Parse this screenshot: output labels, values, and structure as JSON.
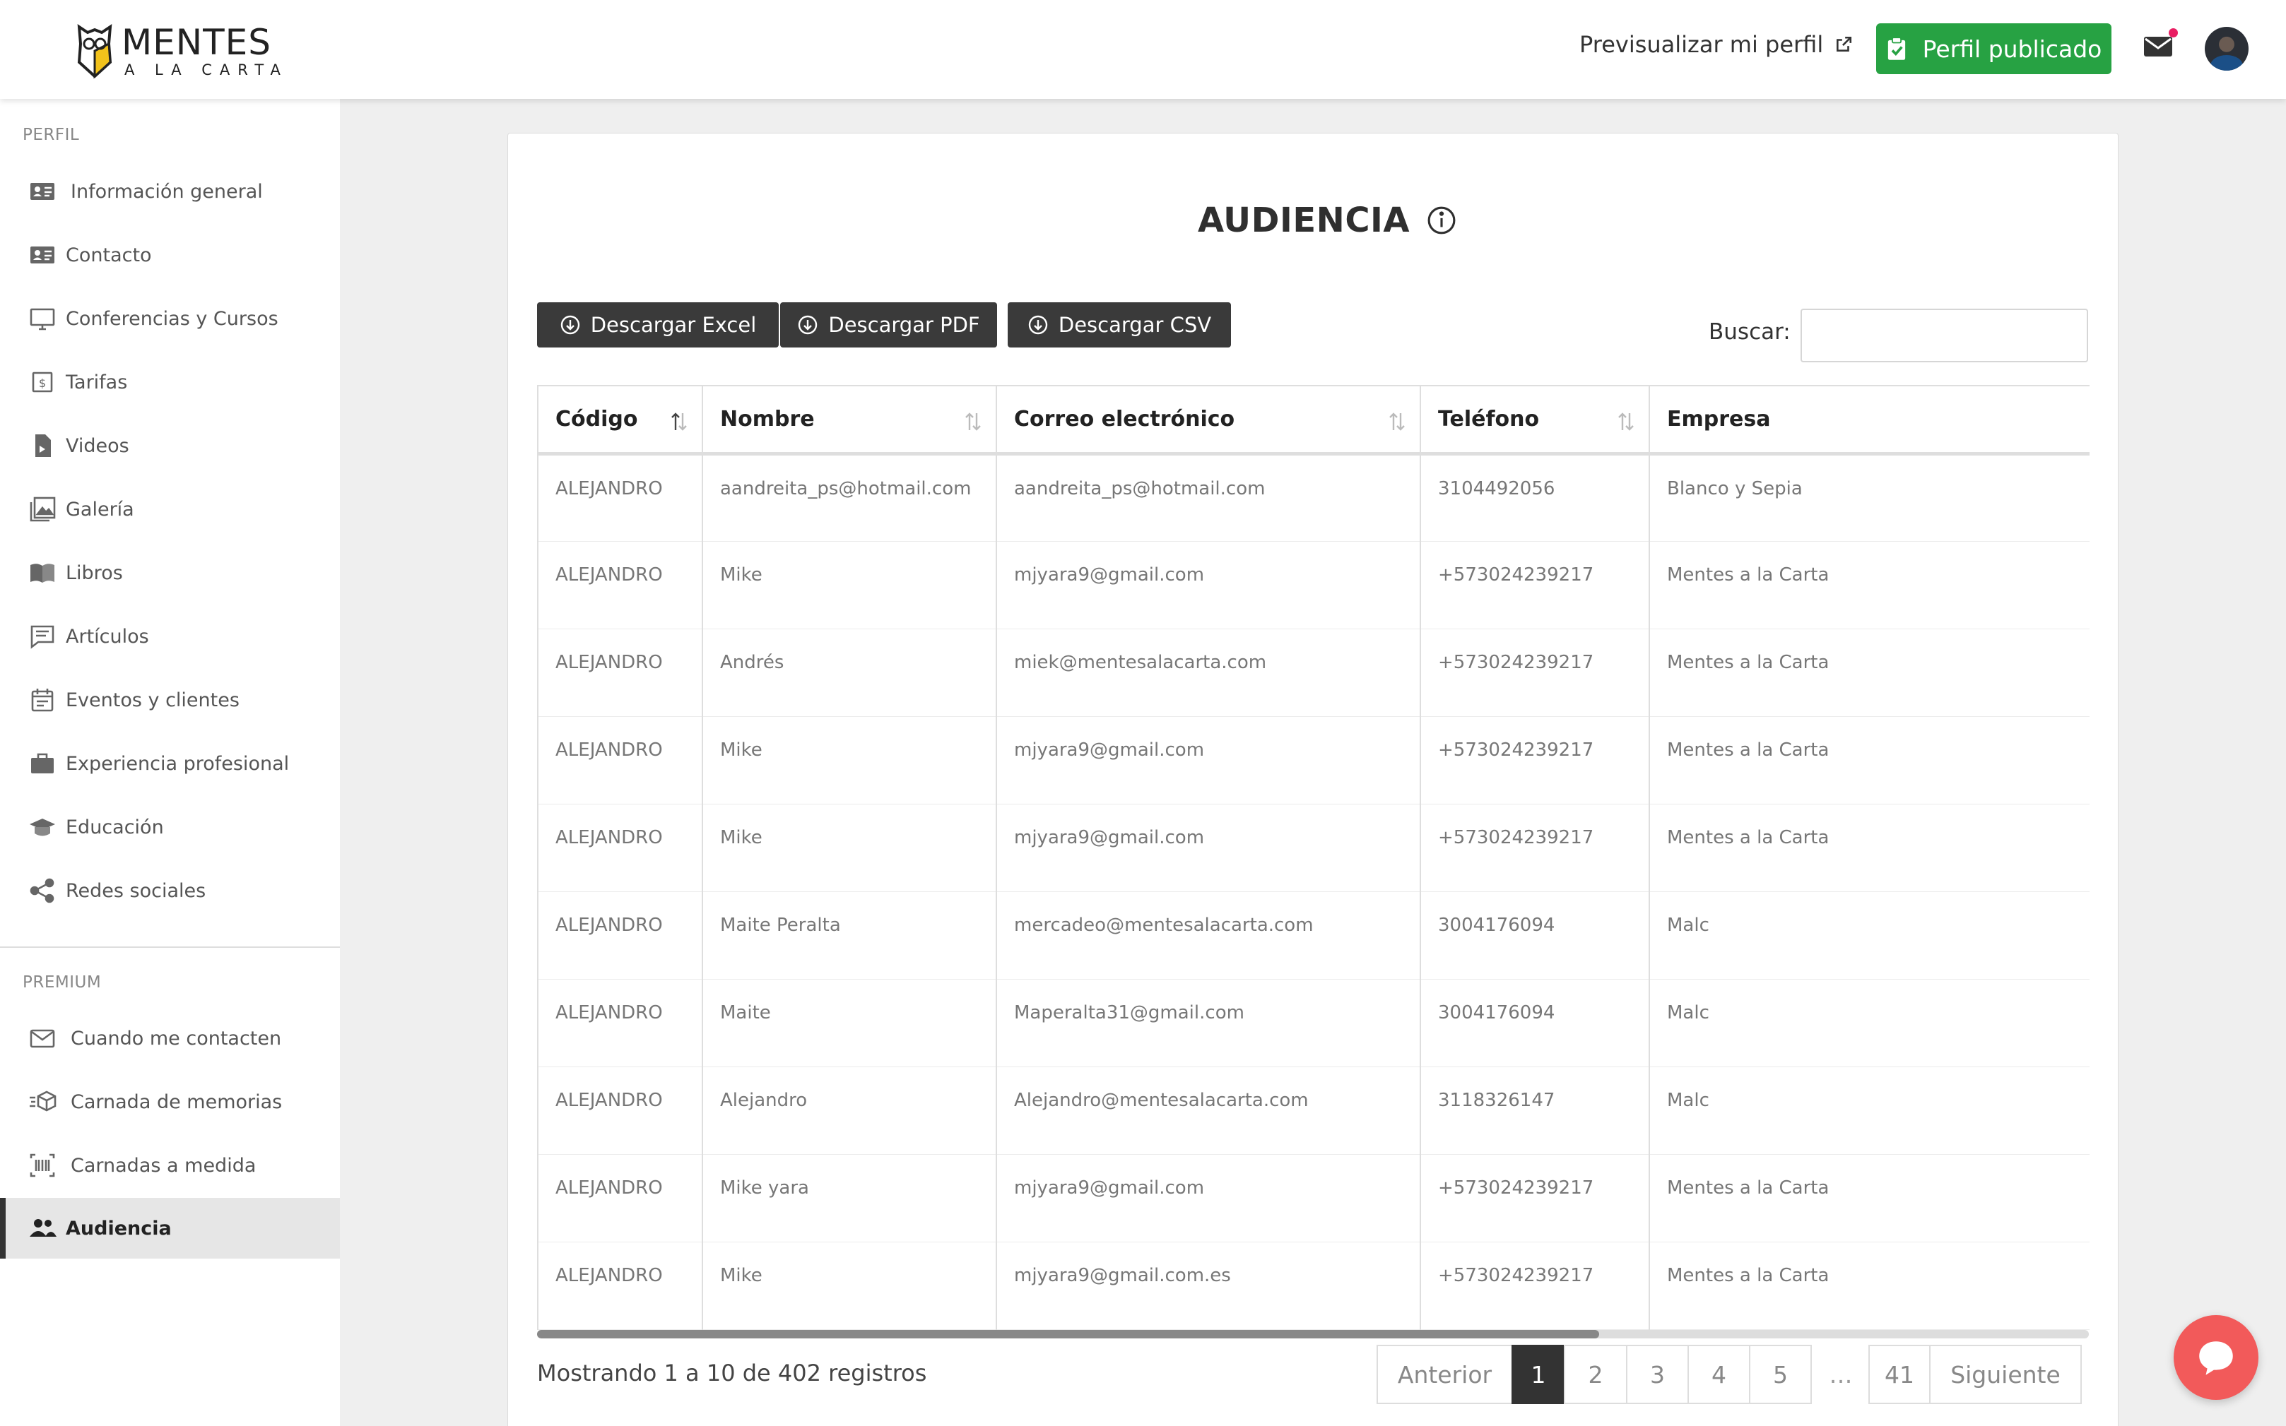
{
  "header": {
    "logo_line1": "MENTES",
    "logo_line2": "A LA CARTA",
    "preview_label": "Previsualizar mi perfil",
    "publish_label": "Perfil publicado",
    "accent_green": "#27a243",
    "notification_dot_color": "#e91e63"
  },
  "sidebar": {
    "section_profile": "PERFIL",
    "section_premium": "PREMIUM",
    "items": [
      {
        "label": "Información general",
        "icon": "id-card-icon"
      },
      {
        "label": "Contacto",
        "icon": "contact-card-icon"
      },
      {
        "label": "Conferencias y Cursos",
        "icon": "presentation-icon"
      },
      {
        "label": "Tarifas",
        "icon": "money-icon"
      },
      {
        "label": "Videos",
        "icon": "video-file-icon"
      },
      {
        "label": "Galería",
        "icon": "gallery-icon"
      },
      {
        "label": "Libros",
        "icon": "book-icon"
      },
      {
        "label": "Artículos",
        "icon": "article-icon"
      },
      {
        "label": "Eventos y clientes",
        "icon": "calendar-icon"
      },
      {
        "label": "Experiencia profesional",
        "icon": "briefcase-icon"
      },
      {
        "label": "Educación",
        "icon": "graduation-cap-icon"
      },
      {
        "label": "Redes sociales",
        "icon": "share-icon"
      }
    ],
    "premium_items": [
      {
        "label": "Cuando me contacten",
        "icon": "envelope-icon"
      },
      {
        "label": "Carnada de memorias",
        "icon": "box-icon"
      },
      {
        "label": "Carnadas a medida",
        "icon": "barcode-icon"
      },
      {
        "label": "Audiencia",
        "icon": "people-icon",
        "active": true
      }
    ]
  },
  "main": {
    "title": "AUDIENCIA",
    "buttons": {
      "excel": "Descargar Excel",
      "pdf": "Descargar PDF",
      "csv": "Descargar CSV"
    },
    "search_label": "Buscar:",
    "search_value": "",
    "columns": [
      "Código",
      "Nombre",
      "Correo electrónico",
      "Teléfono",
      "Empresa"
    ],
    "rows": [
      [
        "ALEJANDRO",
        "aandreita_ps@hotmail.com",
        "aandreita_ps@hotmail.com",
        "3104492056",
        "Blanco y Sepia"
      ],
      [
        "ALEJANDRO",
        "Mike",
        "mjyara9@gmail.com",
        "+573024239217",
        "Mentes a la Carta"
      ],
      [
        "ALEJANDRO",
        "Andrés",
        "miek@mentesalacarta.com",
        "+573024239217",
        "Mentes a la Carta"
      ],
      [
        "ALEJANDRO",
        "Mike",
        "mjyara9@gmail.com",
        "+573024239217",
        "Mentes a la Carta"
      ],
      [
        "ALEJANDRO",
        "Mike",
        "mjyara9@gmail.com",
        "+573024239217",
        "Mentes a la Carta"
      ],
      [
        "ALEJANDRO",
        "Maite Peralta",
        "mercadeo@mentesalacarta.com",
        "3004176094",
        "Malc"
      ],
      [
        "ALEJANDRO",
        "Maite",
        "Maperalta31@gmail.com",
        "3004176094",
        "Malc"
      ],
      [
        "ALEJANDRO",
        "Alejandro",
        "Alejandro@mentesalacarta.com",
        "3118326147",
        "Malc"
      ],
      [
        "ALEJANDRO",
        "Mike yara",
        "mjyara9@gmail.com",
        "+573024239217",
        "Mentes a la Carta"
      ],
      [
        "ALEJANDRO",
        "Mike",
        "mjyara9@gmail.com.es",
        "+573024239217",
        "Mentes a la Carta"
      ]
    ],
    "info": "Mostrando 1 a 10 de 402 registros",
    "pagination": {
      "prev": "Anterior",
      "pages": [
        "1",
        "2",
        "3",
        "4",
        "5"
      ],
      "ellipsis": "…",
      "last": "41",
      "next": "Siguiente",
      "current": "1"
    }
  }
}
